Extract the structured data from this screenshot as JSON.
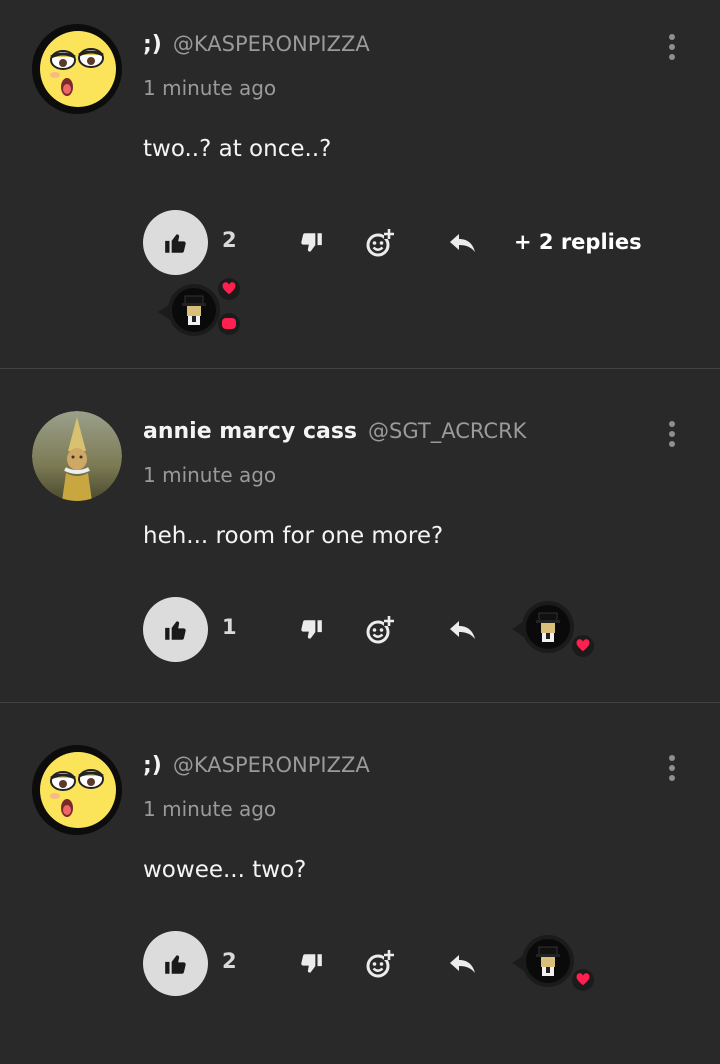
{
  "colors": {
    "background": "#292929",
    "divider": "#434343",
    "text_muted": "#9a9a9a",
    "like_bg": "#dcdcdc",
    "heart": "#ff2050"
  },
  "comments": [
    {
      "display_name": ";)",
      "handle": "@KASPERONPIZZA",
      "timestamp": "1 minute ago",
      "text": "two..? at once..?",
      "likes": "2",
      "replies_label": "+ 2 replies",
      "avatar_icon": "smirk-face-avatar",
      "reactions": [
        "heart-icon",
        "chat-bubble-icon"
      ]
    },
    {
      "display_name": "annie marcy cass",
      "handle": "@SGT_ACRCRK",
      "timestamp": "1 minute ago",
      "text": "heh... room for one more?",
      "likes": "1",
      "avatar_icon": "painting-avatar",
      "reactions": [
        "heart-icon"
      ]
    },
    {
      "display_name": ";)",
      "handle": "@KASPERONPIZZA",
      "timestamp": "1 minute ago",
      "text": "wowee... two?",
      "likes": "2",
      "avatar_icon": "smirk-face-avatar",
      "reactions": [
        "heart-icon"
      ]
    }
  ]
}
